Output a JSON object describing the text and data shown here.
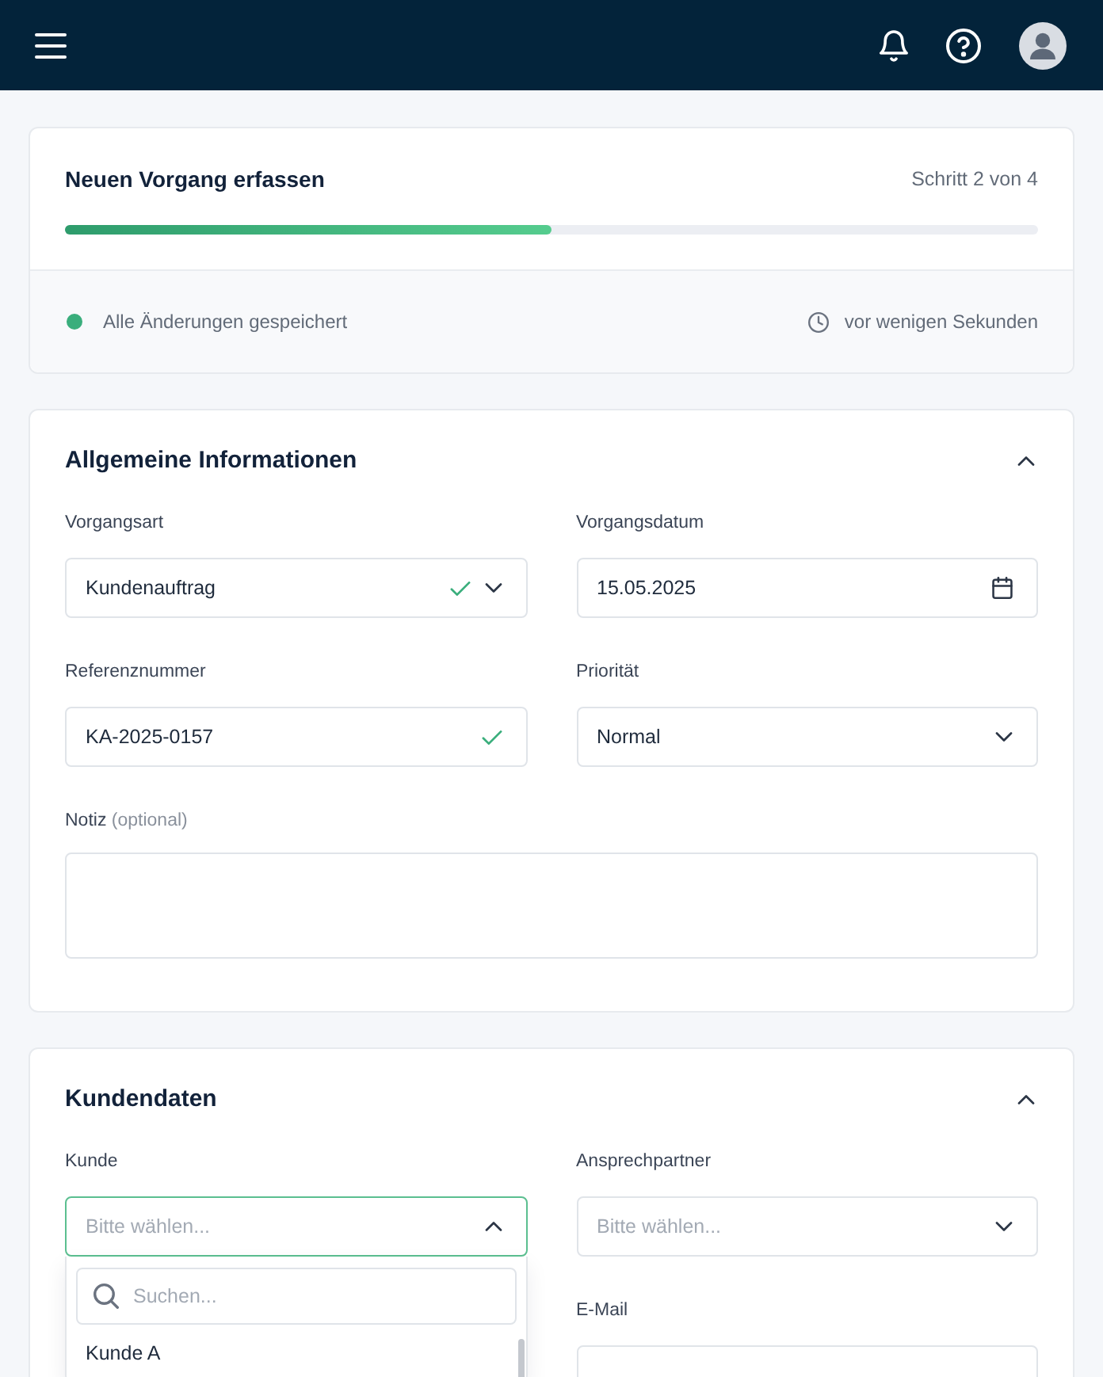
{
  "wizard": {
    "title": "Neuen Vorgang erfassen",
    "step": "Schritt 2 von 4",
    "progress": {
      "level": 0.5
    },
    "save_status": "Alle Änderungen gespeichert",
    "saved_time": "vor wenigen Sekunden"
  },
  "sections": [
    {
      "title": "Allgemeine Informationen",
      "expanded": true,
      "fields": [
        {
          "kind": "select",
          "label": "Vorgangsart",
          "value": "Kundenauftrag",
          "valid": true,
          "open": false
        },
        {
          "kind": "date",
          "label": "Vorgangsdatum",
          "value": "15.05.2025"
        },
        {
          "kind": "text",
          "label": "Referenznummer",
          "value": "KA-2025-0157",
          "valid": true
        },
        {
          "kind": "select",
          "label": "Priorität",
          "value": "Normal",
          "valid": false,
          "open": false
        },
        {
          "kind": "textarea",
          "label": "Notiz",
          "hint": "(optional)"
        }
      ]
    },
    {
      "title": "Kundendaten",
      "expanded": true,
      "fields": [
        {
          "kind": "select",
          "label": "Kunde",
          "placeholder": "Bitte wählen...",
          "valid": false,
          "open": true,
          "search_placeholder": "Suchen...",
          "options": [
            "Kunde A"
          ]
        },
        {
          "kind": "select",
          "label": "Ansprechpartner",
          "placeholder": "Bitte wählen...",
          "valid": false,
          "open": false
        },
        {
          "kind": "text",
          "label": "E-Mail",
          "valid": false
        }
      ]
    }
  ]
}
